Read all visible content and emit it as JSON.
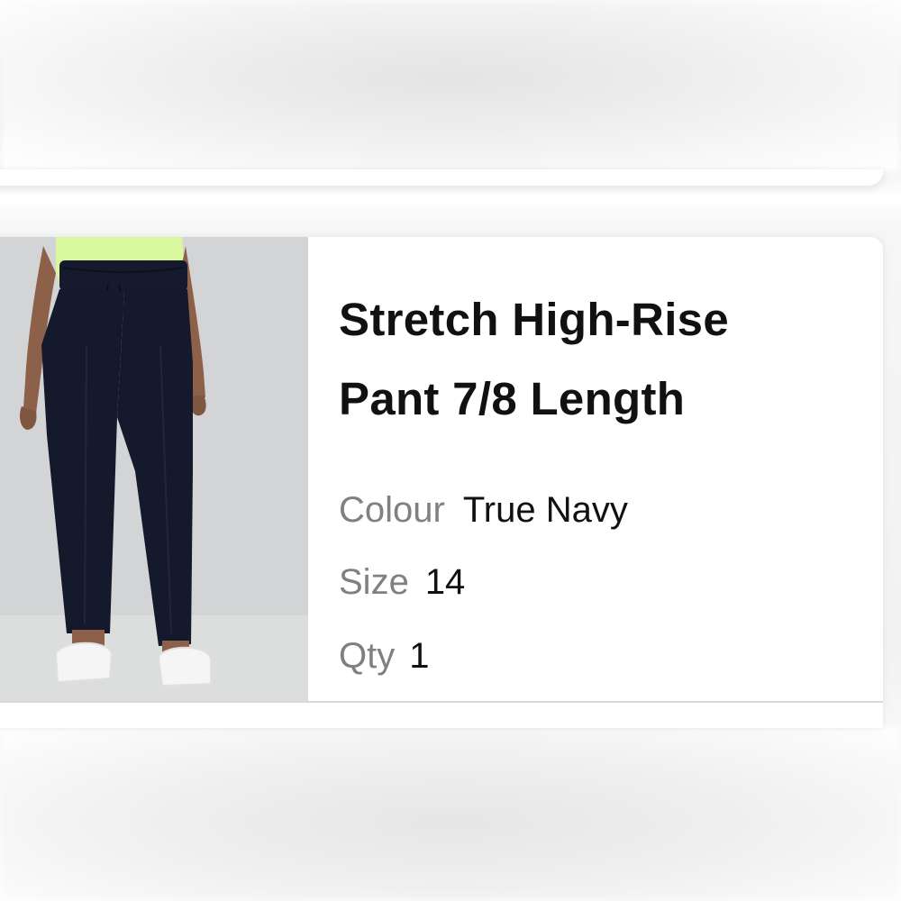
{
  "product": {
    "title_line_1": "Stretch High-Rise",
    "title_line_2": "Pant 7/8 Length",
    "image_icon": "product-photo-navy-pants",
    "attributes": {
      "colour": {
        "label": "Colour",
        "value": "True Navy"
      },
      "size": {
        "label": "Size",
        "value": "14"
      },
      "qty": {
        "label": "Qty",
        "value": "1"
      }
    }
  },
  "colors": {
    "pant": "#141a2b",
    "shirt": "#d8f79a",
    "label_gray": "#808080",
    "text": "#111111"
  }
}
